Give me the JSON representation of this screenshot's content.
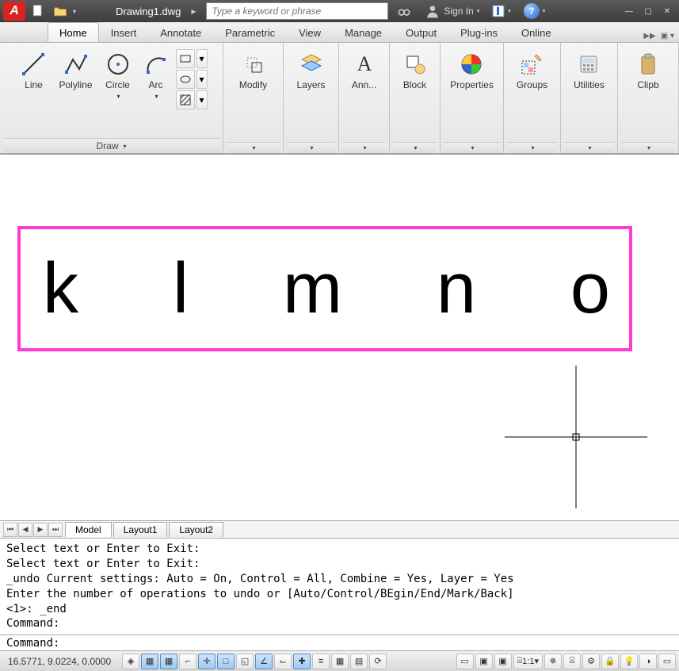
{
  "title": {
    "filename": "Drawing1.dwg",
    "search_placeholder": "Type a keyword or phrase",
    "signin": "Sign In"
  },
  "tabs": [
    "Home",
    "Insert",
    "Annotate",
    "Parametric",
    "View",
    "Manage",
    "Output",
    "Plug-ins",
    "Online"
  ],
  "active_tab": 0,
  "ribbon": {
    "draw": {
      "title": "Draw",
      "line": "Line",
      "polyline": "Polyline",
      "circle": "Circle",
      "arc": "Arc"
    },
    "modify": {
      "title": "Modify"
    },
    "layers": {
      "title": "Layers"
    },
    "ann": {
      "title": "Ann..."
    },
    "block": {
      "title": "Block"
    },
    "properties": {
      "title": "Properties"
    },
    "groups": {
      "title": "Groups"
    },
    "utilities": {
      "title": "Utilities"
    },
    "clipboard": {
      "title": "Clipb"
    }
  },
  "layout_tabs": [
    "Model",
    "Layout1",
    "Layout2"
  ],
  "active_layout": 0,
  "drawing_text": [
    "k",
    "l",
    "m",
    "n",
    "o"
  ],
  "history": [
    "Select text or Enter to Exit:",
    "Select text or Enter to Exit:",
    "_undo Current settings: Auto = On, Control = All, Combine = Yes, Layer = Yes",
    "Enter the number of operations to undo or [Auto/Control/BEgin/End/Mark/Back]",
    "<1>: _end",
    "Command:"
  ],
  "command_prompt": "Command:",
  "status": {
    "coords": "16.5771, 9.0224, 0.0000",
    "scale": "1:1"
  }
}
